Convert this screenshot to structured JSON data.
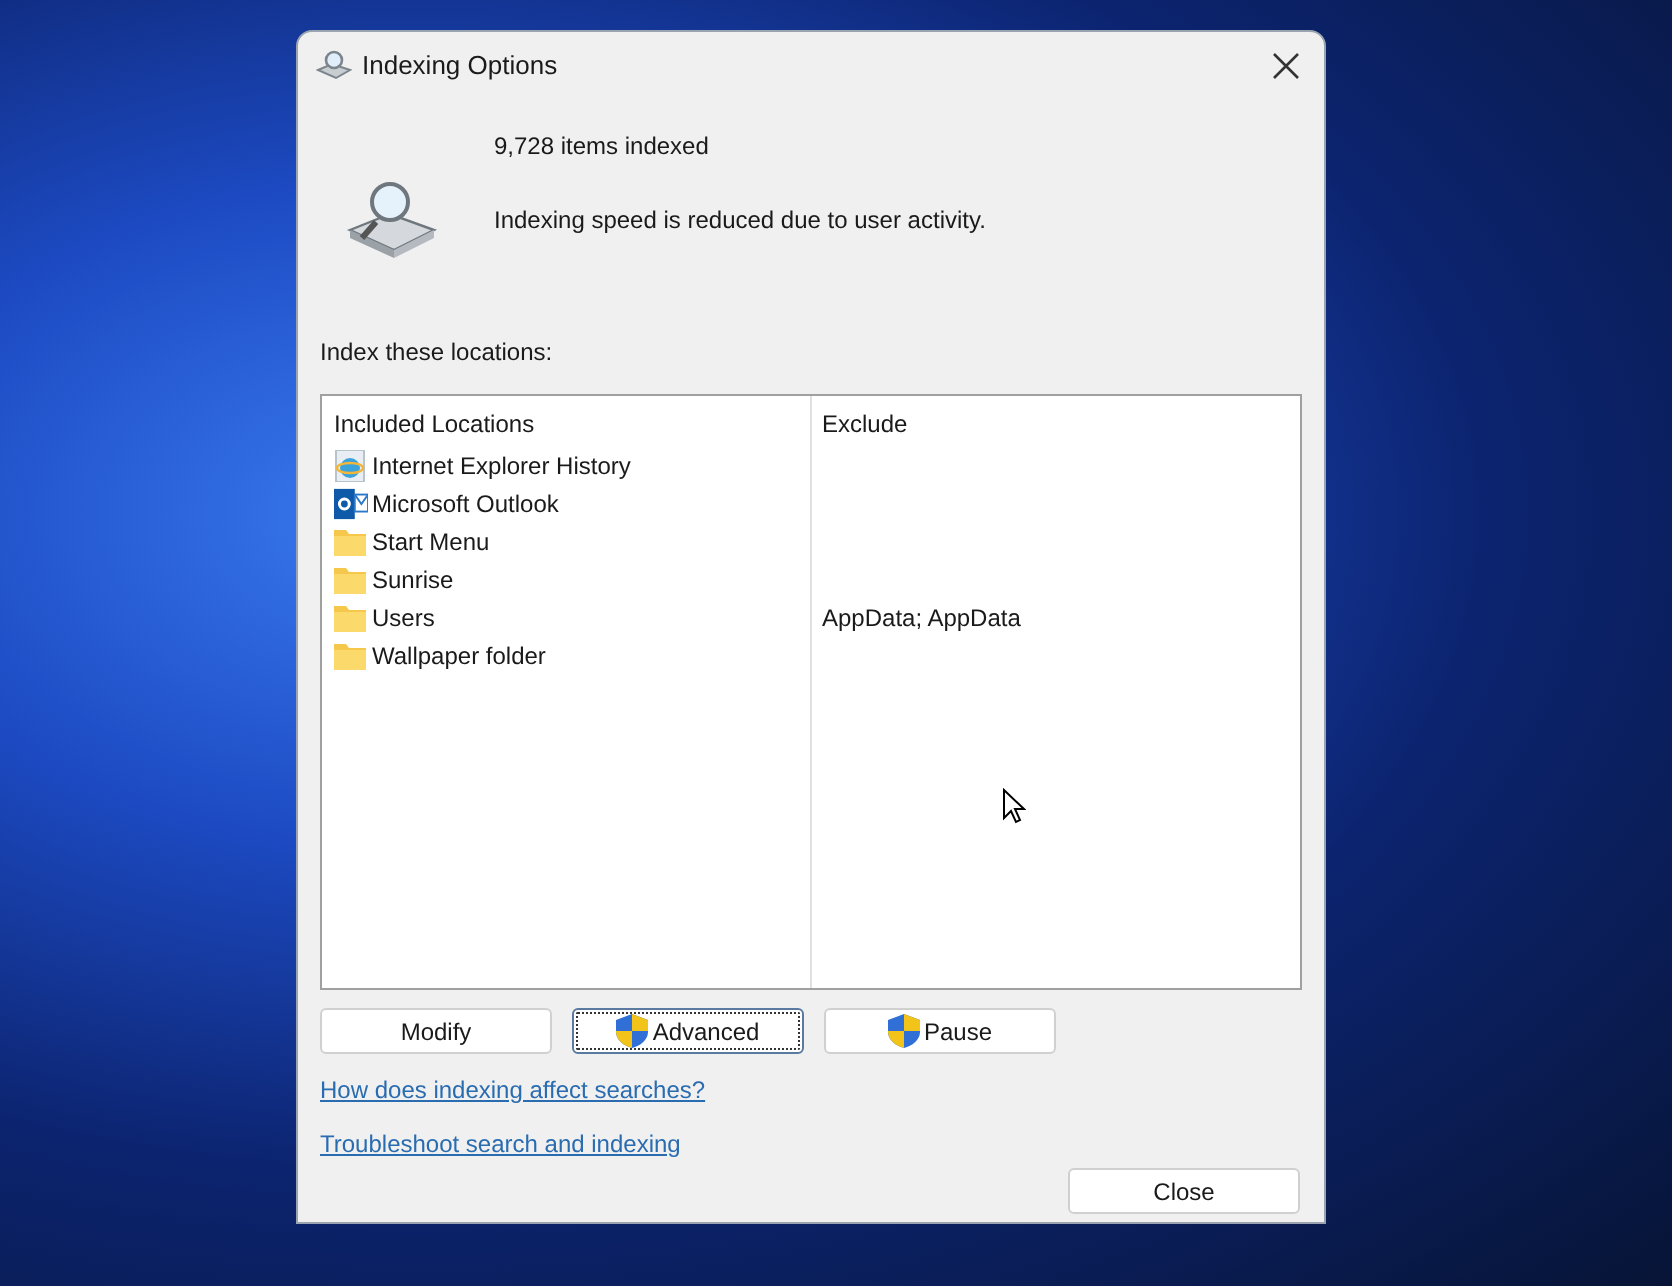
{
  "window": {
    "title": "Indexing Options"
  },
  "status": {
    "count": "9,728 items indexed",
    "message": "Indexing speed is reduced due to user activity."
  },
  "locations_label": "Index these locations:",
  "table": {
    "columns": [
      "Included Locations",
      "Exclude"
    ],
    "rows": [
      {
        "kind": "browser",
        "name": "Internet Explorer History",
        "exclude": ""
      },
      {
        "kind": "mail",
        "name": "Microsoft Outlook",
        "exclude": ""
      },
      {
        "kind": "folder",
        "name": "Start Menu",
        "exclude": ""
      },
      {
        "kind": "folder",
        "name": "Sunrise",
        "exclude": ""
      },
      {
        "kind": "folder",
        "name": "Users",
        "exclude": "AppData; AppData"
      },
      {
        "kind": "folder",
        "name": "Wallpaper folder",
        "exclude": ""
      }
    ]
  },
  "buttons": [
    {
      "label": "Modify",
      "shield": false,
      "focused": false
    },
    {
      "label": "Advanced",
      "shield": true,
      "focused": true
    },
    {
      "label": "Pause",
      "shield": true,
      "focused": false
    }
  ],
  "links": [
    "How does indexing affect searches?",
    "Troubleshoot search and indexing"
  ],
  "close_button": "Close"
}
